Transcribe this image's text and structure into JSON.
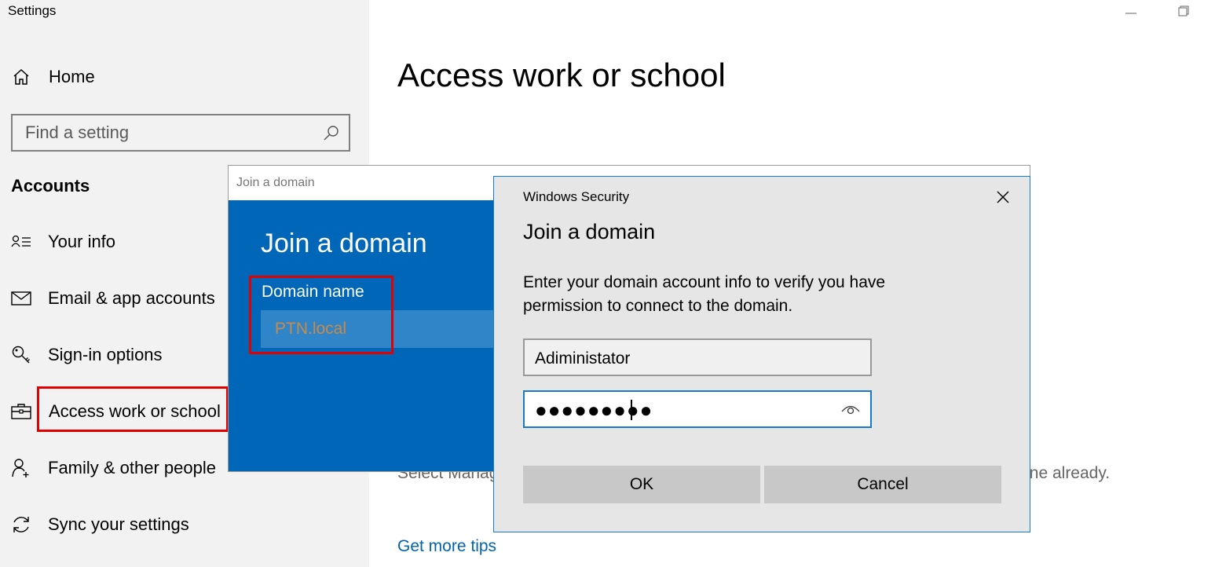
{
  "window": {
    "title": "Settings"
  },
  "sidebar": {
    "home_label": "Home",
    "search_placeholder": "Find a setting",
    "section_title": "Accounts",
    "items": [
      {
        "label": "Your info",
        "icon": "user-info-icon"
      },
      {
        "label": "Email & app accounts",
        "icon": "mail-icon"
      },
      {
        "label": "Sign-in options",
        "icon": "key-icon"
      },
      {
        "label": "Access work or school",
        "icon": "briefcase-icon"
      },
      {
        "label": "Family & other people",
        "icon": "add-person-icon"
      },
      {
        "label": "Sync your settings",
        "icon": "sync-icon"
      }
    ]
  },
  "main": {
    "title": "Access work or school",
    "description": "Select Manage to access resources on your work or school account if you don't have one already.",
    "tips_link": "Get more tips"
  },
  "join_dialog": {
    "window_title": "Join a domain",
    "heading": "Join a domain",
    "domain_label": "Domain name",
    "domain_value": "PTN.local"
  },
  "security_dialog": {
    "window_title": "Windows Security",
    "heading": "Join a domain",
    "description": "Enter your domain account info to verify you have permission to connect to the domain.",
    "username_value": "Adiministator",
    "password_mask": "●●●●●●●●●",
    "ok_label": "OK",
    "cancel_label": "Cancel"
  },
  "colors": {
    "accent": "#0067b8",
    "highlight_border": "#e30000",
    "link": "#0063b1"
  }
}
